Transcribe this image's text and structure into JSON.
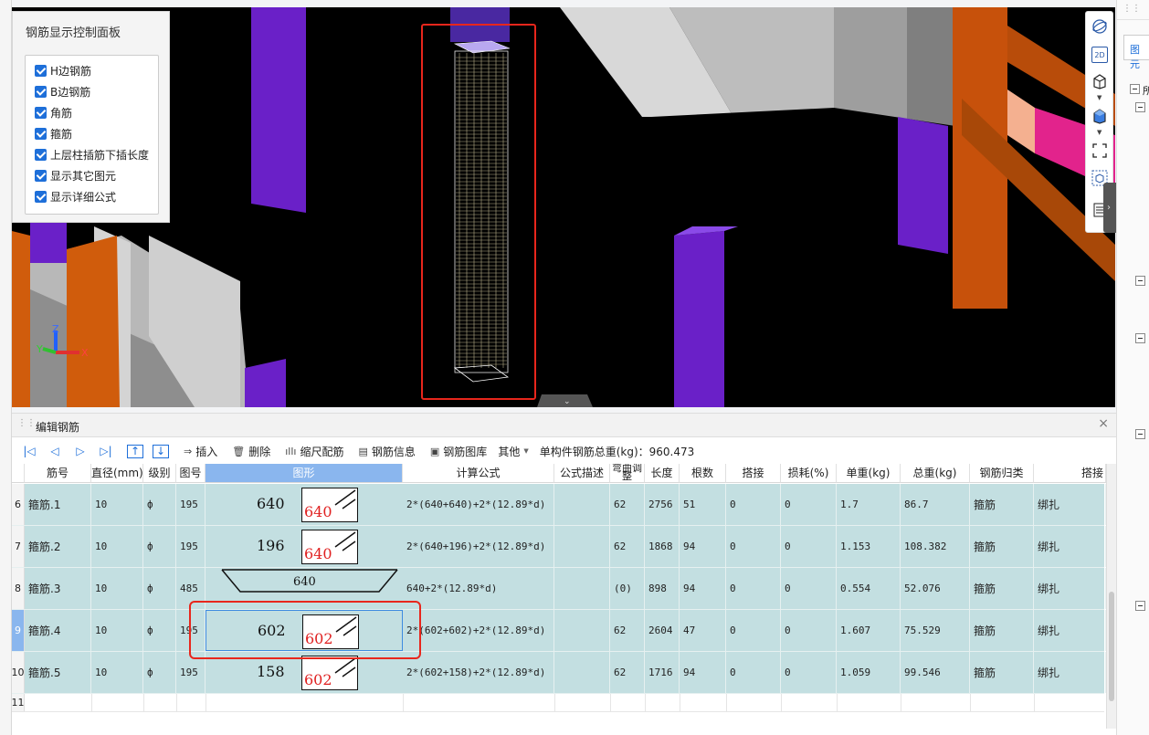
{
  "control_panel": {
    "title": "钢筋显示控制面板",
    "options": [
      {
        "label": "H边钢筋",
        "checked": true
      },
      {
        "label": "B边钢筋",
        "checked": true
      },
      {
        "label": "角筋",
        "checked": true
      },
      {
        "label": "箍筋",
        "checked": true
      },
      {
        "label": "上层柱插筋下插长度",
        "checked": true
      },
      {
        "label": "显示其它图元",
        "checked": true
      },
      {
        "label": "显示详细公式",
        "checked": true
      }
    ]
  },
  "viewport": {
    "axis_labels": {
      "z": "Z",
      "y": "Y",
      "x": "X"
    },
    "highlight_color": "#e8261c"
  },
  "view_toolbar": {
    "icons": [
      "orbit-icon",
      "2d-view-icon",
      "3d-box-icon",
      "solid-box-icon",
      "select-region-icon",
      "cube-select-icon",
      "list-icon"
    ],
    "label_2d": "2D"
  },
  "right_panel": {
    "tab": "图元",
    "tree_label": "所"
  },
  "edit_panel": {
    "title": "编辑钢筋",
    "close": "×",
    "toolbar": {
      "insert": "插入",
      "delete": "删除",
      "scale": "缩尺配筋",
      "info": "钢筋信息",
      "library": "钢筋图库",
      "other": "其他",
      "total_weight": "单构件钢筋总重(kg)：960.473"
    },
    "columns": [
      "筋号",
      "直径(mm)",
      "级别",
      "图号",
      "图形",
      "计算公式",
      "公式描述",
      "弯曲调整",
      "长度",
      "根数",
      "搭接",
      "损耗(%)",
      "单重(kg)",
      "总重(kg)",
      "钢筋归类",
      "搭接"
    ],
    "selected_column": "图形",
    "rows": [
      {
        "no": "6",
        "name": "箍筋.1",
        "dia": "10",
        "grade": "ф",
        "fig": "195",
        "shape_num": "640",
        "shape_inner": "640",
        "formula": "2*(640+640)+2*(12.89*d)",
        "desc": "",
        "bend": "62",
        "len": "2756",
        "count": "51",
        "lap": "0",
        "loss": "0",
        "unit": "1.7",
        "total": "86.7",
        "cat": "箍筋",
        "lapt": "绑扎"
      },
      {
        "no": "7",
        "name": "箍筋.2",
        "dia": "10",
        "grade": "ф",
        "fig": "195",
        "shape_num": "196",
        "shape_inner": "640",
        "formula": "2*(640+196)+2*(12.89*d)",
        "desc": "",
        "bend": "62",
        "len": "1868",
        "count": "94",
        "lap": "0",
        "loss": "0",
        "unit": "1.153",
        "total": "108.382",
        "cat": "箍筋",
        "lapt": "绑扎"
      },
      {
        "no": "8",
        "name": "箍筋.3",
        "dia": "10",
        "grade": "ф",
        "fig": "485",
        "shape_num": "640",
        "shape_inner": "",
        "formula": "640+2*(12.89*d)",
        "desc": "",
        "bend": "(0)",
        "len": "898",
        "count": "94",
        "lap": "0",
        "loss": "0",
        "unit": "0.554",
        "total": "52.076",
        "cat": "箍筋",
        "lapt": "绑扎"
      },
      {
        "no": "9",
        "name": "箍筋.4",
        "dia": "10",
        "grade": "ф",
        "fig": "195",
        "shape_num": "602",
        "shape_inner": "602",
        "formula": "2*(602+602)+2*(12.89*d)",
        "desc": "",
        "bend": "62",
        "len": "2604",
        "count": "47",
        "lap": "0",
        "loss": "0",
        "unit": "1.607",
        "total": "75.529",
        "cat": "箍筋",
        "lapt": "绑扎"
      },
      {
        "no": "10",
        "name": "箍筋.5",
        "dia": "10",
        "grade": "ф",
        "fig": "195",
        "shape_num": "158",
        "shape_inner": "602",
        "formula": "2*(602+158)+2*(12.89*d)",
        "desc": "",
        "bend": "62",
        "len": "1716",
        "count": "94",
        "lap": "0",
        "loss": "0",
        "unit": "1.059",
        "total": "99.546",
        "cat": "箍筋",
        "lapt": "绑扎"
      }
    ],
    "empty_row": "11",
    "selected_row": "9"
  }
}
